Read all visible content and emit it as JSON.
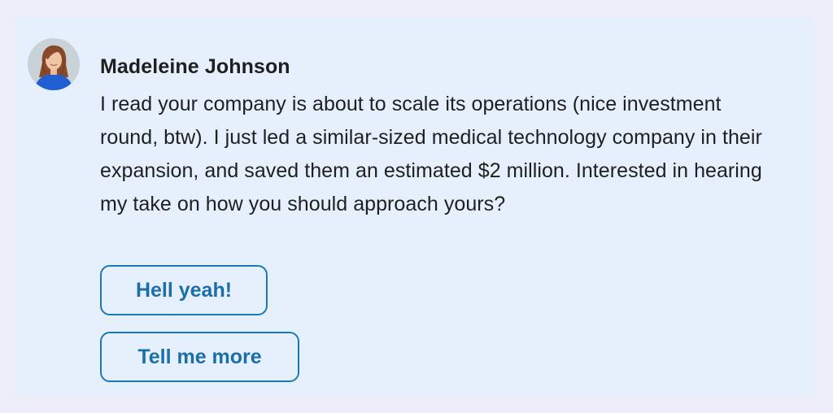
{
  "message": {
    "sender_name": "Madeleine Johnson",
    "body": "I read your company is about to scale its operations (nice investment round, btw). I just led a similar-sized medical technology company in their expansion, and saved them an estimated $2 million. Interested in hearing my take on how you should approach yours?",
    "avatar_icon": "avatar-photo-icon"
  },
  "replies": [
    {
      "label": "Hell yeah!"
    },
    {
      "label": "Tell me more"
    }
  ],
  "colors": {
    "page_background": "#eeeefa",
    "card_background": "#e6f0fc",
    "text": "#1f1f1f",
    "accent": "#1a7ab4"
  }
}
